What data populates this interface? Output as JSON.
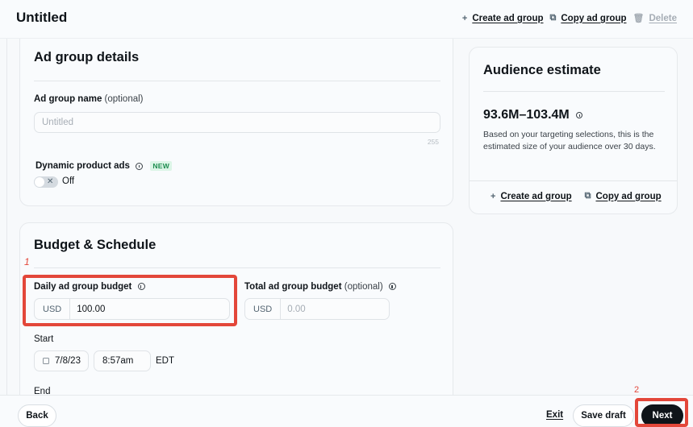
{
  "header": {
    "title": "Untitled",
    "actions": [
      {
        "icon": "plus-icon",
        "label": "Create ad group",
        "disabled": false
      },
      {
        "icon": "copy-icon",
        "label": "Copy ad group",
        "disabled": false
      },
      {
        "icon": "trash-icon",
        "label": "Delete",
        "disabled": true
      }
    ]
  },
  "ad_group_details": {
    "title": "Ad group details",
    "name_label": "Ad group name",
    "name_optional": "(optional)",
    "name_placeholder": "Untitled",
    "name_value": "",
    "char_count": "255",
    "dpa_label": "Dynamic product ads",
    "dpa_badge": "NEW",
    "dpa_toggle_state": "Off",
    "dpa_toggle_on": false
  },
  "budget_schedule": {
    "title": "Budget & Schedule",
    "daily_label": "Daily ad group budget",
    "daily_currency": "USD",
    "daily_value": "100.00",
    "total_label": "Total ad group budget",
    "total_optional": "(optional)",
    "total_currency": "USD",
    "total_placeholder": "0.00",
    "start_label": "Start",
    "start_date": "7/8/23",
    "start_time": "8:57am",
    "timezone": "EDT",
    "end_label": "End"
  },
  "audience": {
    "title": "Audience estimate",
    "range": "93.6M–103.4M",
    "description": "Based on your targeting selections, this is the estimated size of your audience over 30 days.",
    "create_label": "Create ad group",
    "copy_label": "Copy ad group"
  },
  "footer": {
    "back_label": "Back",
    "exit_label": "Exit",
    "save_draft_label": "Save draft",
    "next_label": "Next"
  },
  "annotations": {
    "mark_1": "1",
    "mark_2": "2",
    "color": "#e3473a"
  }
}
